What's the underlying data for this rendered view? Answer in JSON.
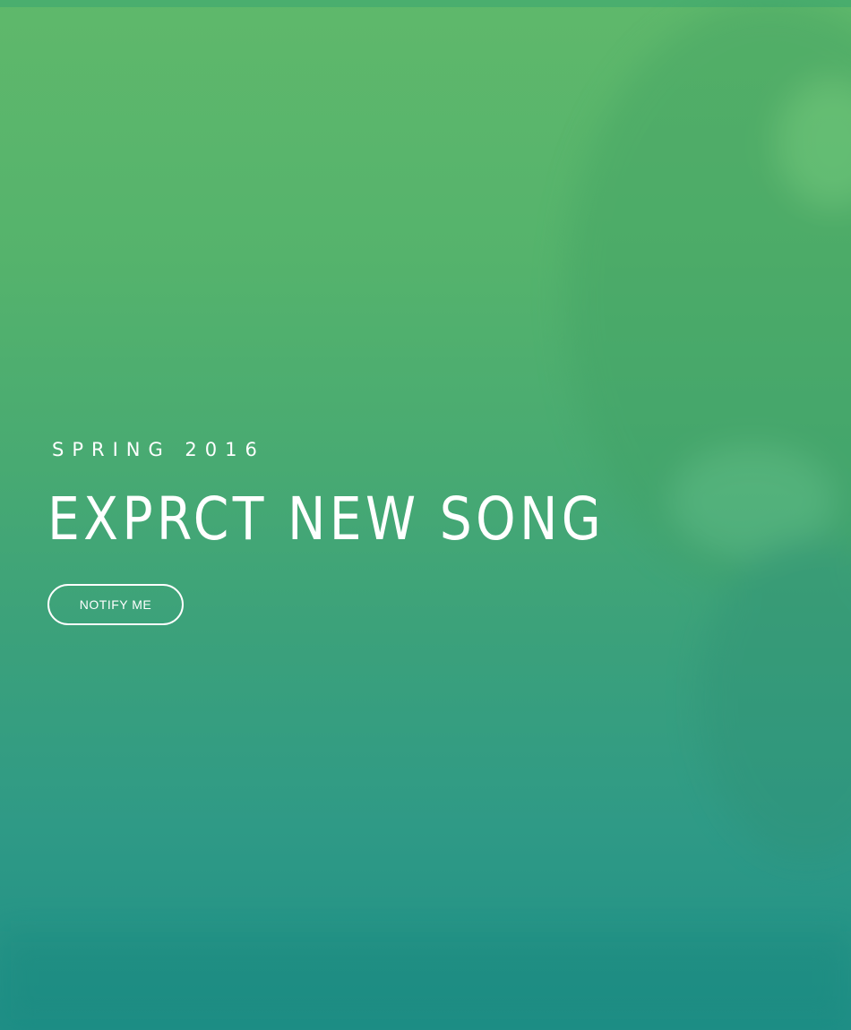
{
  "hero": {
    "season": "SPRING 2016",
    "headline": "EXPRCT NEW SONG",
    "cta_label": "NOTIFY ME"
  },
  "colors": {
    "gradient_top": "#5fb86b",
    "gradient_bottom": "#1f8f87",
    "text": "#ffffff"
  }
}
